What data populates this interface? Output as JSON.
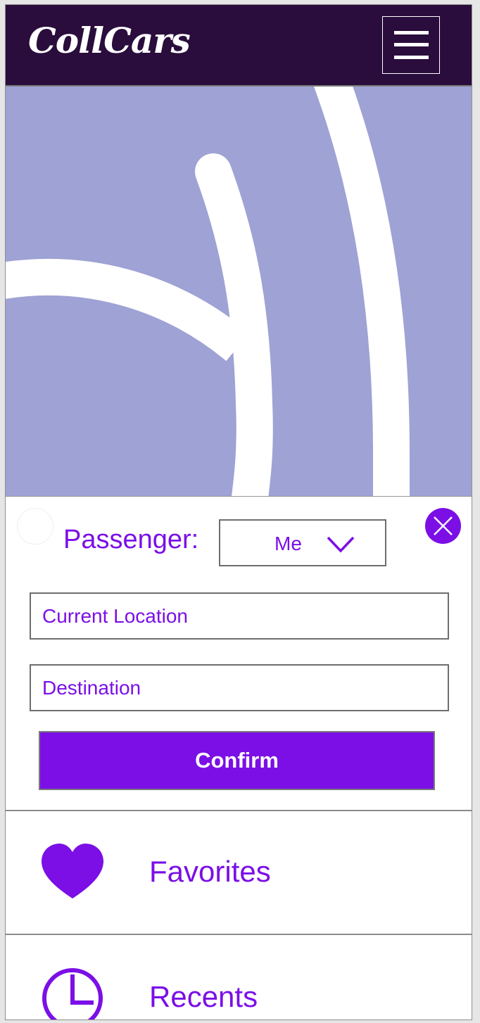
{
  "app": {
    "logo_text": "CollCars"
  },
  "colors": {
    "header_bg": "#2a0d3c",
    "accent": "#7b0fe6",
    "map_bg": "#9ea2d4"
  },
  "header": {
    "menu_icon": "hamburger-menu-icon"
  },
  "booking": {
    "passenger_label": "Passenger:",
    "passenger_value": "Me",
    "passenger_dropdown_icon": "chevron-down-icon",
    "close_icon": "close-icon",
    "current_location_placeholder": "Current Location",
    "destination_placeholder": "Destination",
    "confirm_label": "Confirm"
  },
  "menu": {
    "favorites": {
      "label": "Favorites",
      "icon": "heart-icon"
    },
    "recents": {
      "label": "Recents",
      "icon": "clock-icon"
    }
  }
}
